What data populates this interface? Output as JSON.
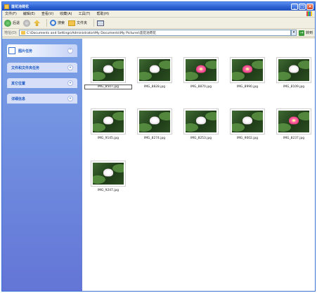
{
  "window": {
    "title": "莲花池荷花",
    "buttons": {
      "minimize": "_",
      "maximize": "□",
      "close": "×"
    }
  },
  "menu": [
    "文件(F)",
    "编辑(E)",
    "查看(V)",
    "收藏(A)",
    "工具(T)",
    "帮助(H)"
  ],
  "toolbar": {
    "back_label": "后退",
    "search_label": "搜索",
    "folders_label": "文件夹"
  },
  "address": {
    "label": "地址(D)",
    "value": "C:\\Documents and Settings\\Administrator\\My Documents\\My Pictures\\莲花池荷花",
    "go_label": "转到"
  },
  "tasks": [
    {
      "label": "图片任务",
      "chevron": "⌃"
    },
    {
      "label": "文件和文件夹任务",
      "chevron": "»"
    },
    {
      "label": "其它位置",
      "chevron": "»"
    },
    {
      "label": "详细信息",
      "chevron": "»"
    }
  ],
  "files": [
    {
      "name": "IMG_8507.jpg",
      "flower": "white",
      "selected": true
    },
    {
      "name": "IMG_8828.jpg",
      "flower": "white"
    },
    {
      "name": "IMG_8870.jpg",
      "flower": "pink"
    },
    {
      "name": "IMG_8990.jpg",
      "flower": "pink"
    },
    {
      "name": "IMG_8109.jpg",
      "flower": "white"
    },
    {
      "name": "IMG_9145.jpg",
      "flower": "white"
    },
    {
      "name": "IMG_8274.jpg",
      "flower": "white"
    },
    {
      "name": "IMG_8253.jpg",
      "flower": "white"
    },
    {
      "name": "IMG_9002.jpg",
      "flower": "white"
    },
    {
      "name": "IMG_8237.jpg",
      "flower": "pink"
    },
    {
      "name": "IMG_9247.jpg",
      "flower": "white"
    }
  ]
}
